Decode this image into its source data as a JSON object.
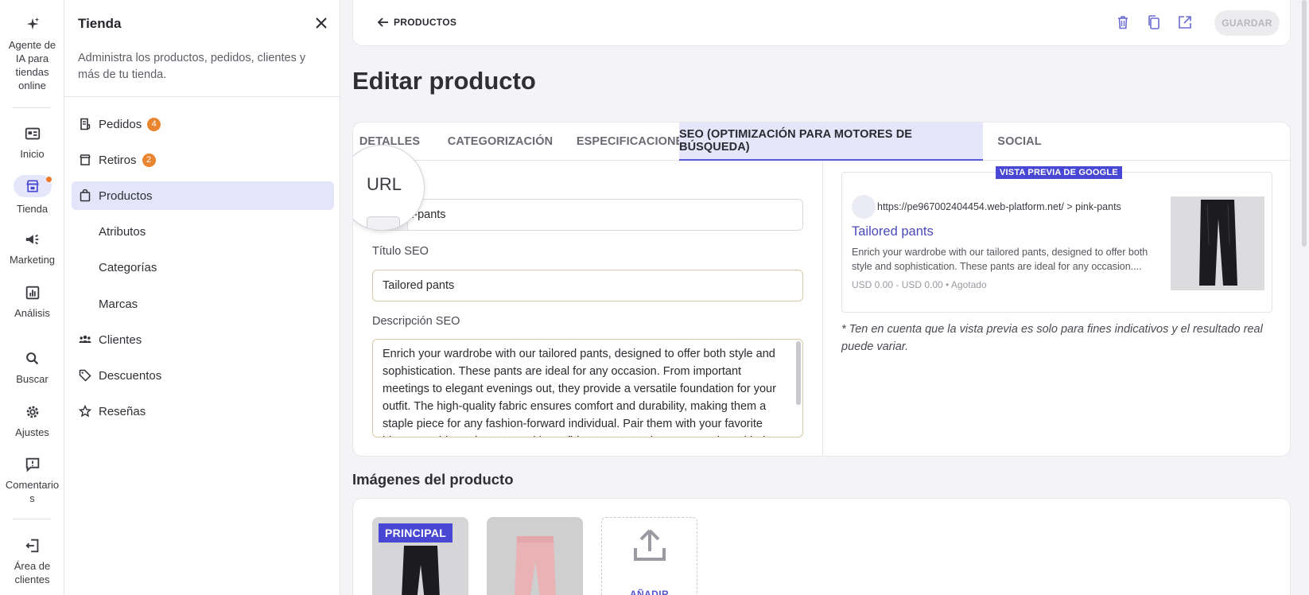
{
  "rail": {
    "items": [
      {
        "label": "Agente de IA para tiendas online",
        "icon": "sparkle-icon"
      },
      {
        "label": "Inicio",
        "icon": "home-icon"
      },
      {
        "label": "Tienda",
        "icon": "store-icon"
      },
      {
        "label": "Marketing",
        "icon": "megaphone-icon"
      },
      {
        "label": "Análisis",
        "icon": "chart-icon"
      },
      {
        "label": "Buscar",
        "icon": "search-icon"
      },
      {
        "label": "Ajustes",
        "icon": "gear-icon"
      },
      {
        "label": "Comentarios",
        "icon": "feedback-icon"
      },
      {
        "label": "Área de clientes",
        "icon": "logout-icon"
      }
    ]
  },
  "sidebar": {
    "title": "Tienda",
    "description": "Administra los productos, pedidos, clientes y más de tu tienda.",
    "items": [
      {
        "label": "Pedidos",
        "icon": "receipt-icon",
        "badge": "4"
      },
      {
        "label": "Retiros",
        "icon": "pickup-icon",
        "badge": "2"
      },
      {
        "label": "Productos",
        "icon": "bag-icon"
      },
      {
        "label": "Atributos"
      },
      {
        "label": "Categorías"
      },
      {
        "label": "Marcas"
      },
      {
        "label": "Clientes",
        "icon": "people-icon"
      },
      {
        "label": "Descuentos",
        "icon": "tag-icon"
      },
      {
        "label": "Reseñas",
        "icon": "star-icon"
      }
    ]
  },
  "topbar": {
    "back_label": "PRODUCTOS",
    "save_label": "GUARDAR"
  },
  "page": {
    "title": "Editar producto"
  },
  "tabs": [
    "DETALLES",
    "CATEGORIZACIÓN",
    "ESPECIFICACIONES",
    "SEO (OPTIMIZACIÓN PARA MOTORES DE BÚSQUEDA)",
    "SOCIAL"
  ],
  "seo": {
    "url_label": "URL",
    "url_prefix": "/",
    "url_value": "pink-pants",
    "url_value_visible": "k-pants",
    "title_label": "Título SEO",
    "title_value": "Tailored pants",
    "desc_label": "Descripción SEO",
    "desc_value": "Enrich your wardrobe with our tailored pants, designed to offer both style and sophistication. These pants are ideal for any occasion. From important meetings to elegant evenings out, they provide a versatile foundation for your outfit. The high-quality fabric ensures comfort and durability, making them a staple piece for any fashion-forward individual. Pair them with your favorite blouse or shirt and step out with confidence. Have a bummer, setting with the"
  },
  "preview": {
    "tag": "VISTA PREVIA DE GOOGLE",
    "url": "https://pe967002404454.web-platform.net/ > pink-pants",
    "title": "Tailored pants",
    "desc": "Enrich your wardrobe with our tailored pants, designed to offer both style and sophistication. These pants are ideal for any occasion....",
    "price": "USD 0.00 - USD 0.00 • Agotado",
    "note": "* Ten en cuenta que la vista previa es solo para fines indicativos y el resultado real puede variar."
  },
  "images": {
    "title": "Imágenes del producto",
    "principal_label": "PRINCIPAL",
    "add_label": "AÑADIR"
  },
  "colors": {
    "accent": "#4848d4",
    "active_bg": "#e4e4fa",
    "badge": "#e9842f"
  }
}
